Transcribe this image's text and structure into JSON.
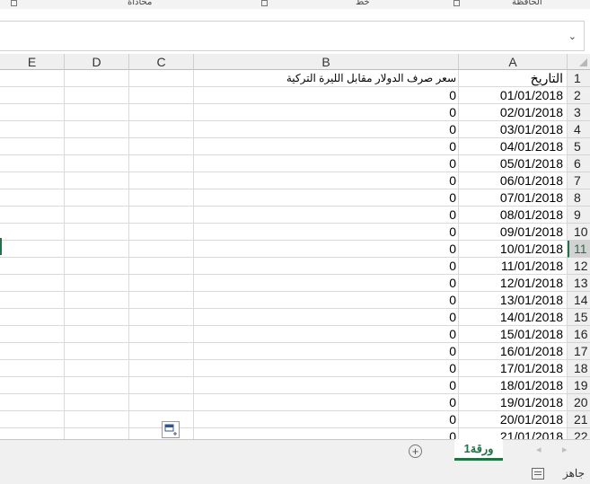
{
  "ribbon": {
    "groups": [
      {
        "label": "محاذاة"
      },
      {
        "label": "خط"
      },
      {
        "label": "الحافظة"
      }
    ]
  },
  "columns": [
    "E",
    "D",
    "C",
    "B",
    "A"
  ],
  "header_row": {
    "row": "1",
    "A": "التاريخ",
    "B": "سعر صرف الدولار مقابل الليرة  التركية"
  },
  "rows": [
    {
      "row": "2",
      "A": "01/01/2018",
      "B": "0"
    },
    {
      "row": "3",
      "A": "02/01/2018",
      "B": "0"
    },
    {
      "row": "4",
      "A": "03/01/2018",
      "B": "0"
    },
    {
      "row": "5",
      "A": "04/01/2018",
      "B": "0"
    },
    {
      "row": "6",
      "A": "05/01/2018",
      "B": "0"
    },
    {
      "row": "7",
      "A": "06/01/2018",
      "B": "0"
    },
    {
      "row": "8",
      "A": "07/01/2018",
      "B": "0"
    },
    {
      "row": "9",
      "A": "08/01/2018",
      "B": "0"
    },
    {
      "row": "10",
      "A": "09/01/2018",
      "B": "0"
    },
    {
      "row": "11",
      "A": "10/01/2018",
      "B": "0"
    },
    {
      "row": "12",
      "A": "11/01/2018",
      "B": "0"
    },
    {
      "row": "13",
      "A": "12/01/2018",
      "B": "0"
    },
    {
      "row": "14",
      "A": "13/01/2018",
      "B": "0"
    },
    {
      "row": "15",
      "A": "14/01/2018",
      "B": "0"
    },
    {
      "row": "16",
      "A": "15/01/2018",
      "B": "0"
    },
    {
      "row": "17",
      "A": "16/01/2018",
      "B": "0"
    },
    {
      "row": "18",
      "A": "17/01/2018",
      "B": "0"
    },
    {
      "row": "19",
      "A": "18/01/2018",
      "B": "0"
    },
    {
      "row": "20",
      "A": "19/01/2018",
      "B": "0"
    },
    {
      "row": "21",
      "A": "20/01/2018",
      "B": "0"
    },
    {
      "row": "22",
      "A": "21/01/2018",
      "B": "0"
    }
  ],
  "selected_row": "11",
  "sheet_tab": {
    "label": "ورقة1"
  },
  "status": {
    "ready": "جاهز"
  },
  "icons": {
    "add_sheet": "plus-circle-icon",
    "autofill": "quick-analysis-icon",
    "formula_expand": "chevron-down-icon"
  },
  "colors": {
    "accent": "#217346"
  }
}
